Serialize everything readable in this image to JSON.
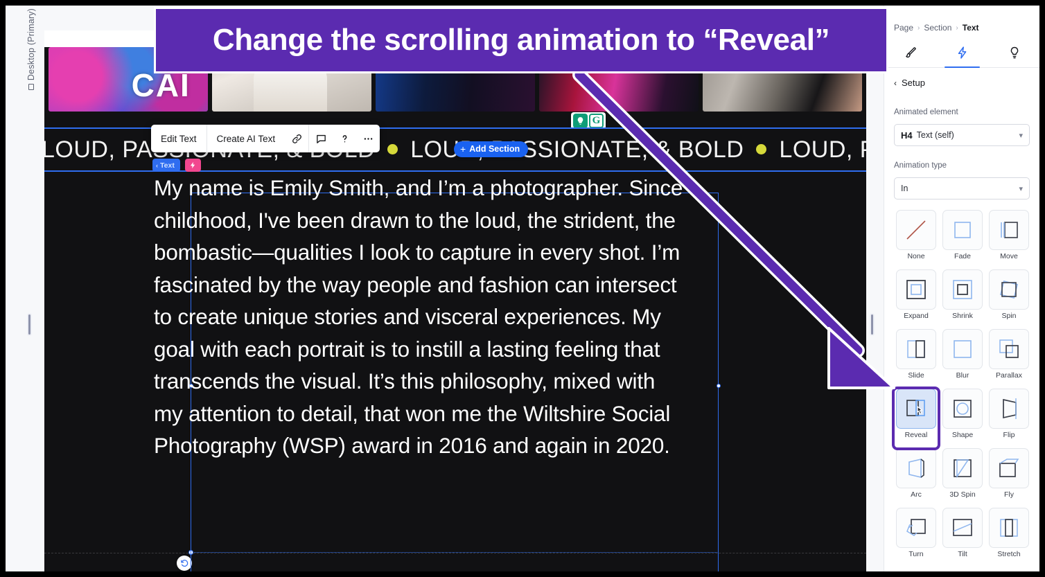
{
  "banner": {
    "text": "Change the scrolling animation to “Reveal”"
  },
  "left_rail": {
    "device_label": "Desktop (Primary)"
  },
  "canvas": {
    "add_section_label": "Add Section",
    "add_section_plus": "+",
    "marquee_text": "LOUD, PASSIONATE, & BOLD",
    "grammarly_g": "G",
    "photo_caption": "CAI",
    "toolbar": {
      "edit_text": "Edit Text",
      "create_ai_text": "Create AI Text",
      "link_icon": "link-icon",
      "comment_icon": "comment-icon",
      "help_icon": "help-icon",
      "more_icon": "more-options-icon"
    },
    "badges": {
      "text_label": "Text",
      "bolt_icon": "lightning-bolt-icon"
    },
    "body_copy": "My name is Emily Smith, and I’m a photographer. Since childhood, I've been drawn to the loud, the strident, the bombastic—qualities I look to capture in every shot. I’m fascinated by the way people and fashion can intersect to create unique stories and visceral experiences. My goal with each portrait is to instill a lasting feeling that transcends the visual. It’s this philosophy, mixed with my attention to detail, that won me the Wiltshire Social Photography (WSP) award in 2016 and again in 2020."
  },
  "right_panel": {
    "breadcrumb": {
      "page": "Page",
      "section": "Section",
      "text": "Text",
      "separator": "›"
    },
    "tabs": [
      {
        "name": "design",
        "icon": "paintbrush-icon",
        "active": false
      },
      {
        "name": "animation",
        "icon": "lightning-bolt-icon",
        "active": true
      },
      {
        "name": "insights",
        "icon": "lightbulb-icon",
        "active": false
      }
    ],
    "setup_label": "Setup",
    "back_chevron": "‹",
    "animated_element": {
      "label": "Animated element",
      "tag": "H4",
      "value": "Text (self)"
    },
    "animation_type": {
      "label": "Animation type",
      "value": "In"
    },
    "animations": [
      {
        "name": "None",
        "selected": false
      },
      {
        "name": "Fade",
        "selected": false
      },
      {
        "name": "Move",
        "selected": false
      },
      {
        "name": "Expand",
        "selected": false
      },
      {
        "name": "Shrink",
        "selected": false
      },
      {
        "name": "Spin",
        "selected": false
      },
      {
        "name": "Slide",
        "selected": false
      },
      {
        "name": "Blur",
        "selected": false
      },
      {
        "name": "Parallax",
        "selected": false
      },
      {
        "name": "Reveal",
        "selected": true
      },
      {
        "name": "Shape",
        "selected": false
      },
      {
        "name": "Flip",
        "selected": false
      },
      {
        "name": "Arc",
        "selected": false
      },
      {
        "name": "3D Spin",
        "selected": false
      },
      {
        "name": "Fly",
        "selected": false
      },
      {
        "name": "Turn",
        "selected": false
      },
      {
        "name": "Tilt",
        "selected": false
      },
      {
        "name": "Stretch",
        "selected": false
      }
    ]
  },
  "colors": {
    "accent_purple": "#5b2bb0",
    "accent_blue": "#2f6df0",
    "badge_pink": "#f2478f",
    "canvas_dark": "#111113",
    "marquee_dot": "#d6d93a",
    "grammarly_green": "#0f9d77"
  }
}
